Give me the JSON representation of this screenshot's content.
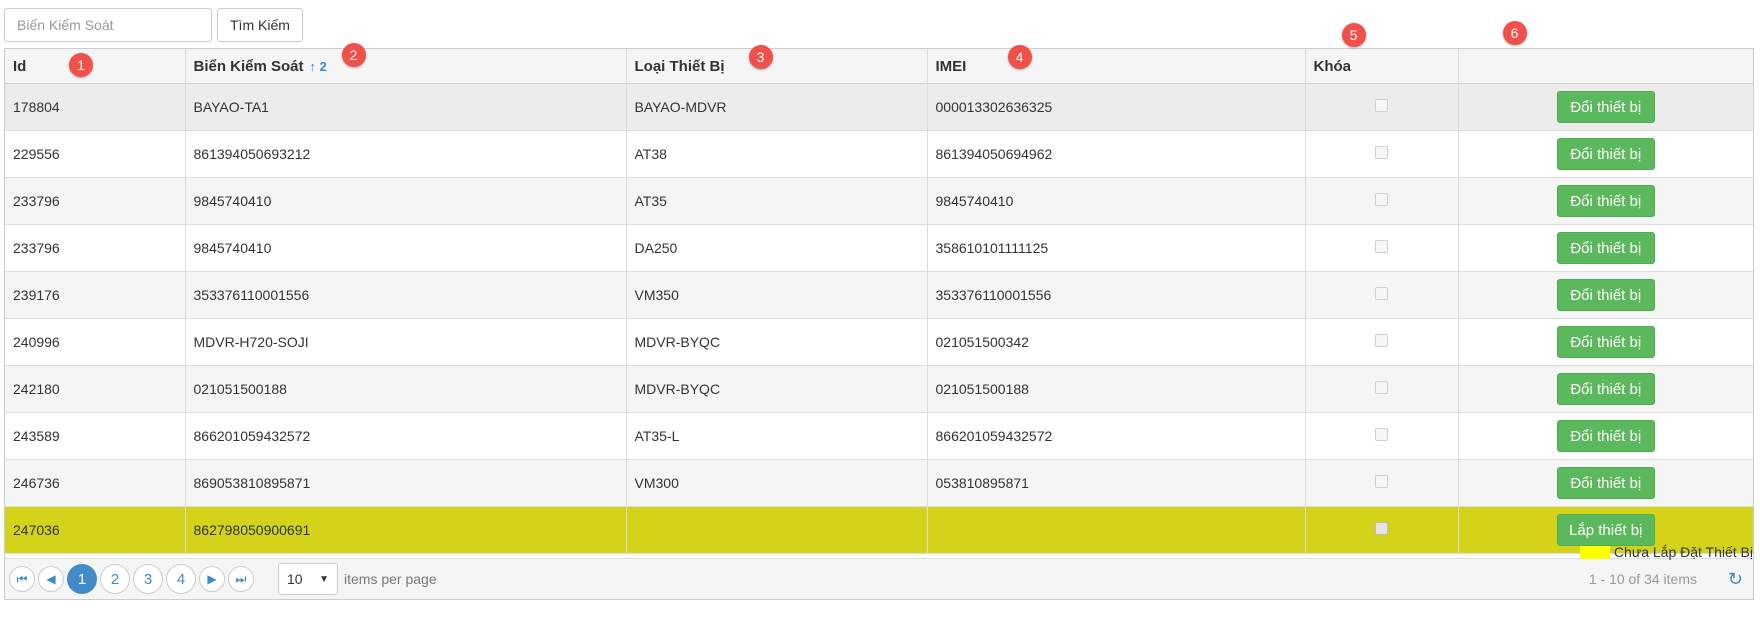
{
  "search": {
    "placeholder": "Biển Kiểm Soát",
    "button_label": "Tìm Kiếm"
  },
  "table": {
    "columns": [
      {
        "label": "Id",
        "badge": "1"
      },
      {
        "label": "Biển Kiểm Soát",
        "badge": "2",
        "sort": "↑ 2"
      },
      {
        "label": "Loại Thiết Bị",
        "badge": "3"
      },
      {
        "label": "IMEI",
        "badge": "4"
      },
      {
        "label": "Khóa",
        "badge": "5"
      },
      {
        "label": "",
        "badge": "6"
      }
    ],
    "rows": [
      {
        "id": "178804",
        "plate": "BAYAO-TA1",
        "type": "BAYAO-MDVR",
        "imei": "000013302636325",
        "action": "Đổi thiết bị"
      },
      {
        "id": "229556",
        "plate": "861394050693212",
        "type": "AT38",
        "imei": "861394050694962",
        "action": "Đổi thiết bị"
      },
      {
        "id": "233796",
        "plate": "9845740410",
        "type": "AT35",
        "imei": "9845740410",
        "action": "Đổi thiết bị"
      },
      {
        "id": "233796",
        "plate": "9845740410",
        "type": "DA250",
        "imei": "358610101111125",
        "action": "Đổi thiết bị"
      },
      {
        "id": "239176",
        "plate": "353376110001556",
        "type": "VM350",
        "imei": "353376110001556",
        "action": "Đổi thiết bị"
      },
      {
        "id": "240996",
        "plate": "MDVR-H720-SOJI",
        "type": "MDVR-BYQC",
        "imei": "021051500342",
        "action": "Đổi thiết bị"
      },
      {
        "id": "242180",
        "plate": "021051500188",
        "type": "MDVR-BYQC",
        "imei": "021051500188",
        "action": "Đổi thiết bị"
      },
      {
        "id": "243589",
        "plate": "866201059432572",
        "type": "AT35-L",
        "imei": "866201059432572",
        "action": "Đổi thiết bị"
      },
      {
        "id": "246736",
        "plate": "869053810895871",
        "type": "VM300",
        "imei": "053810895871",
        "action": "Đổi thiết bị"
      },
      {
        "id": "247036",
        "plate": "862798050900691",
        "type": "",
        "imei": "",
        "action": "Lắp thiết bị"
      }
    ]
  },
  "pager": {
    "pages": [
      "1",
      "2",
      "3",
      "4"
    ],
    "current_page": "1",
    "page_size": "10",
    "items_per_page_label": "items per page",
    "info": "1 - 10 of 34 items"
  },
  "legend": {
    "label": "Chưa Lắp Đặt Thiết Bị",
    "color": "#ffff00"
  },
  "colors": {
    "accent": "#428bca",
    "action_button": "#5cb85c",
    "uninstalled_row": "#d4d319",
    "badge": "#f0504a"
  }
}
